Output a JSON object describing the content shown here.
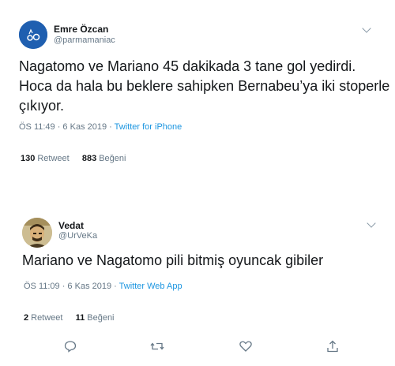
{
  "tweets": [
    {
      "display_name": "Emre Özcan",
      "handle": "@parmamaniac",
      "text": "Nagatomo ve Mariano 45 dakikada 3 tane gol yedirdi. Hoca da hala bu beklere sahipken Bernabeu’ya iki stoperle çıkıyor.",
      "time": "ÖS 11:49 · 6 Kas 2019 · ",
      "source": "Twitter for iPhone",
      "retweet_count": "130",
      "retweet_label": "Retweet",
      "like_count": "883",
      "like_label": "Beğeni"
    },
    {
      "display_name": "Vedat",
      "handle": "@UrVeKa",
      "text": "Mariano ve Nagatomo pili bitmiş oyuncak gibiler",
      "time": "ÖS 11:09 · 6 Kas 2019 · ",
      "source": "Twitter Web App",
      "retweet_count": "2",
      "retweet_label": "Retweet",
      "like_count": "11",
      "like_label": "Beğeni"
    }
  ],
  "actions": [
    "reply-icon",
    "retweet-icon",
    "like-icon",
    "share-icon"
  ]
}
